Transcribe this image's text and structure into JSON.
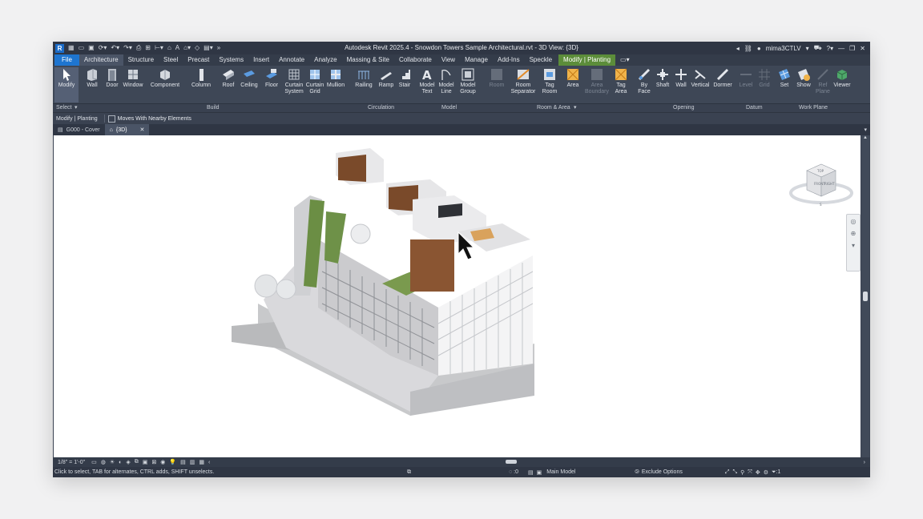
{
  "titlebar": {
    "app_title": "Autodesk Revit 2025.4 - Snowdon Towers Sample Architectural.rvt - 3D View: {3D}",
    "user": "mima3CTLV",
    "logo": "R"
  },
  "tabs": [
    "File",
    "Architecture",
    "Structure",
    "Steel",
    "Precast",
    "Systems",
    "Insert",
    "Annotate",
    "Analyze",
    "Massing & Site",
    "Collaborate",
    "View",
    "Manage",
    "Add-Ins",
    "Speckle"
  ],
  "context_tab": "Modify | Planting",
  "ribbon": {
    "modify": "Modify",
    "wall": "Wall",
    "door": "Door",
    "window": "Window",
    "component": "Component",
    "column": "Column",
    "roof": "Roof",
    "ceiling": "Ceiling",
    "floor": "Floor",
    "curtain_system": "Curtain\nSystem",
    "curtain_grid": "Curtain\nGrid",
    "mullion": "Mullion",
    "railing": "Railing",
    "ramp": "Ramp",
    "stair": "Stair",
    "model_text": "Model\nText",
    "model_line": "Model\nLine",
    "model_group": "Model\nGroup",
    "room": "Room",
    "room_separator": "Room\nSeparator",
    "tag_room": "Tag\nRoom",
    "area": "Area",
    "area_boundary": "Area\nBoundary",
    "tag_area": "Tag\nArea",
    "by_face": "By\nFace",
    "shaft": "Shaft",
    "wall_opening": "Wall",
    "vertical": "Vertical",
    "dormer": "Dormer",
    "level": "Level",
    "grid": "Grid",
    "set": "Set",
    "show": "Show",
    "ref_plane": "Ref\nPlane",
    "viewer": "Viewer"
  },
  "panels": {
    "select": "Select",
    "build": "Build",
    "circulation": "Circulation",
    "model": "Model",
    "room_area": "Room & Area",
    "opening": "Opening",
    "datum": "Datum",
    "work_plane": "Work Plane"
  },
  "options_bar": {
    "context": "Modify | Planting",
    "moves_with": "Moves With Nearby Elements"
  },
  "doc_tabs": [
    "G000 - Cover",
    "{3D}"
  ],
  "viewcube": {
    "top": "TOP",
    "front": "FRONT",
    "right": "RIGHT",
    "compass": "S"
  },
  "view_bar": {
    "scale": "1/8\" = 1'-0\""
  },
  "status": {
    "hint": "Click to select, TAB for alternates, CTRL adds, SHIFT unselects.",
    "model": "Main Model",
    "exclude": "Exclude Options",
    "filter_count": ":1",
    "workset_count": ":0"
  },
  "colors": {
    "chrome": "#3b4453",
    "titlebar": "#2f3644",
    "accent": "#1e75d0",
    "context_tab": "#5c8d3a",
    "viewport": "#ffffff"
  }
}
